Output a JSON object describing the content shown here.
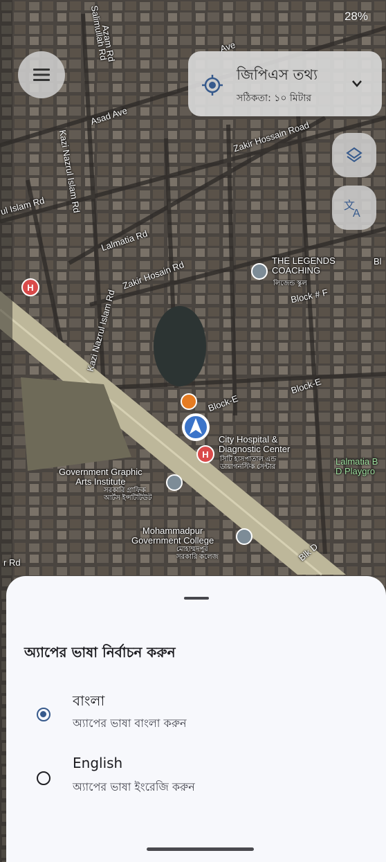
{
  "status_bar": {
    "battery": "28%"
  },
  "map_labels": {
    "salimullah_rd": "Salimullah Rd",
    "azam_rd": "Azam Rd",
    "asad_ave_top": "Ave",
    "asad_ave": "Asad Ave",
    "kazi_nazrul_top": "Kazi Nazrul Islam Rd",
    "nazrul_left": "ul Islam Rd",
    "zakir_hossain_road": "Zakir Hossain Road",
    "lalmatia_rd": "Lalmatia Rd",
    "zakir_hosain_rd": "Zakir Hosain Rd",
    "kazi_nazrul_mid": "Kazi Nazrul Islam Rd",
    "legends": "THE LEGENDS\nCOACHING",
    "legends_bn": "লিজেন্ড স্কুল",
    "block_f": "Block # F",
    "block_e1": "Block-E",
    "block_e2": "Block-E",
    "city_hospital": "City Hospital &\nDiagnostic Center",
    "city_hospital_bn": "সিটি হাসপাতাল এন্ড\nডায়াগনস্টিক সেন্টার",
    "lalmatia_playground": "Lalmatia B\nD Playgro",
    "govt_graphic": "Government Graphic\nArts Institute",
    "govt_graphic_bn": "সরকারি গ্রাফিক\nআর্টস ইন্সটিটিউট",
    "mohammadpur_college": "Mohammadpur\nGovernment College",
    "mohammadpur_bn": "মোহাম্মদপুর\nসরকারি কলেজ",
    "blk_d": "Blk D",
    "r_rd": "r Rd",
    "bl_right": "Bl"
  },
  "gps_card": {
    "title": "জিপিএস তথ্য",
    "accuracy": "সঠিকতা: ১০ মিটার"
  },
  "language_sheet": {
    "title": "অ্যাপের ভাষা নির্বাচন করুন",
    "options": [
      {
        "label": "বাংলা",
        "description": "অ্যাপের ভাষা বাংলা করুন",
        "selected": true
      },
      {
        "label": "English",
        "description": "অ্যাপের ভাষা ইংরেজি করুন",
        "selected": false
      }
    ]
  },
  "colors": {
    "accent": "#375a8c",
    "sheet_bg": "#f7f8fc",
    "card_bg": "#dcdcdc"
  }
}
